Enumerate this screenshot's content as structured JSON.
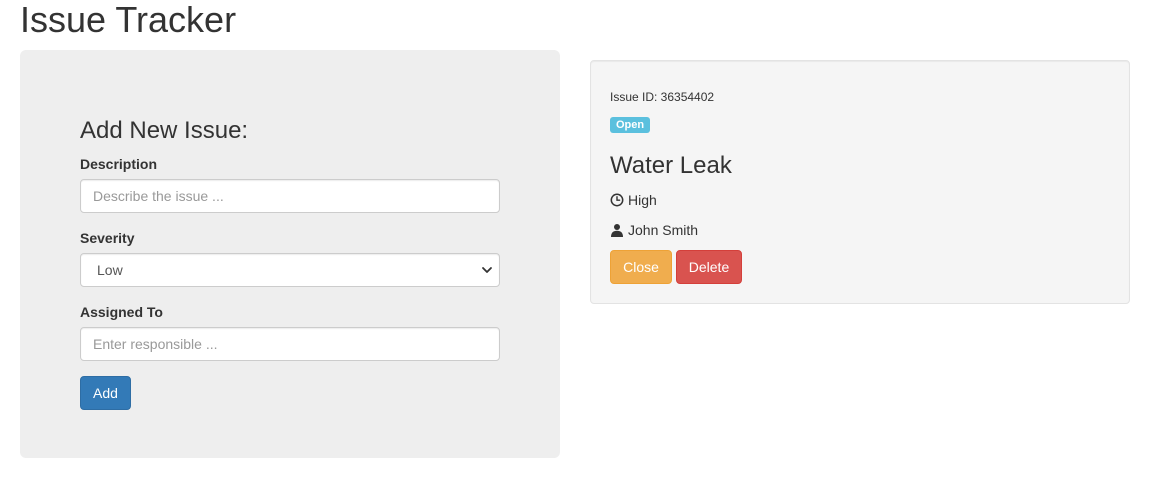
{
  "app": {
    "title": "Issue Tracker"
  },
  "form": {
    "heading": "Add New Issue:",
    "description": {
      "label": "Description",
      "placeholder": "Describe the issue ...",
      "value": ""
    },
    "severity": {
      "label": "Severity",
      "selected": "Low"
    },
    "assigned_to": {
      "label": "Assigned To",
      "placeholder": "Enter responsible ...",
      "value": ""
    },
    "add_label": "Add"
  },
  "issue": {
    "id_text": "Issue ID: 36354402",
    "status": "Open",
    "title": "Water Leak",
    "severity": "High",
    "assignee": "John Smith",
    "close_label": "Close",
    "delete_label": "Delete"
  },
  "icons": {
    "severity": "clock-icon",
    "assignee": "user-icon",
    "dropdown": "chevron-down-icon"
  },
  "colors": {
    "primary": "#337ab7",
    "warning": "#f0ad4e",
    "danger": "#d9534f",
    "info": "#5bc0de"
  }
}
